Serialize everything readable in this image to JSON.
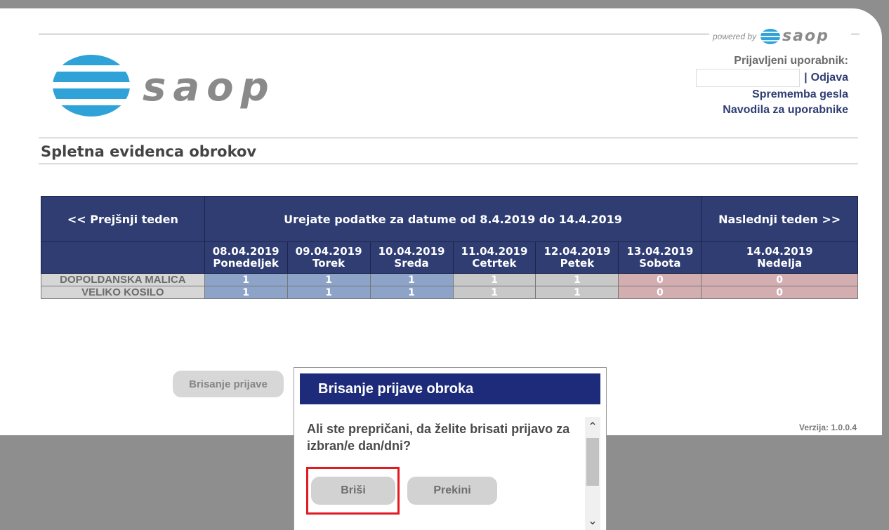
{
  "header": {
    "powered_by": "powered by",
    "small_logo_text": "saop",
    "logo_text": "saop",
    "user_label": "Prijavljeni uporabnik:",
    "user_name": "",
    "separator": "|",
    "logout": "Odjava",
    "change_password": "Sprememba gesla",
    "user_guide": "Navodila za uporabnike"
  },
  "page_title": "Spletna evidenca obrokov",
  "table": {
    "prev_week": "<< Prejšnji teden",
    "range_label": "Urejate podatke za datume od 8.4.2019 do 14.4.2019",
    "next_week": "Naslednji teden >>",
    "days": [
      {
        "date": "08.04.2019",
        "name": "Ponedeljek"
      },
      {
        "date": "09.04.2019",
        "name": "Torek"
      },
      {
        "date": "10.04.2019",
        "name": "Sreda"
      },
      {
        "date": "11.04.2019",
        "name": "Cetrtek"
      },
      {
        "date": "12.04.2019",
        "name": "Petek"
      },
      {
        "date": "13.04.2019",
        "name": "Sobota"
      },
      {
        "date": "14.04.2019",
        "name": "Nedelja"
      }
    ],
    "rows": [
      {
        "meal": "DOPOLDANSKA MALICA",
        "values": [
          "1",
          "1",
          "1",
          "1",
          "1",
          "0",
          "0"
        ]
      },
      {
        "meal": "VELIKO KOSILO",
        "values": [
          "1",
          "1",
          "1",
          "1",
          "1",
          "0",
          "0"
        ]
      }
    ],
    "colors": {
      "selected": "#8ea3c8",
      "weekday": "#c8c8c8",
      "weekend": "#d3aeb0",
      "header": "#2f3d73"
    }
  },
  "delete_registration_button": "Brisanje prijave",
  "version": "Verzija: 1.0.0.4",
  "dialog": {
    "title": "Brisanje prijave obroka",
    "message": "Ali ste prepričani, da želite brisati prijavo za izbran/e dan/dni?",
    "confirm": "Briši",
    "cancel": "Prekini",
    "highlight_color": "#e11b22"
  }
}
